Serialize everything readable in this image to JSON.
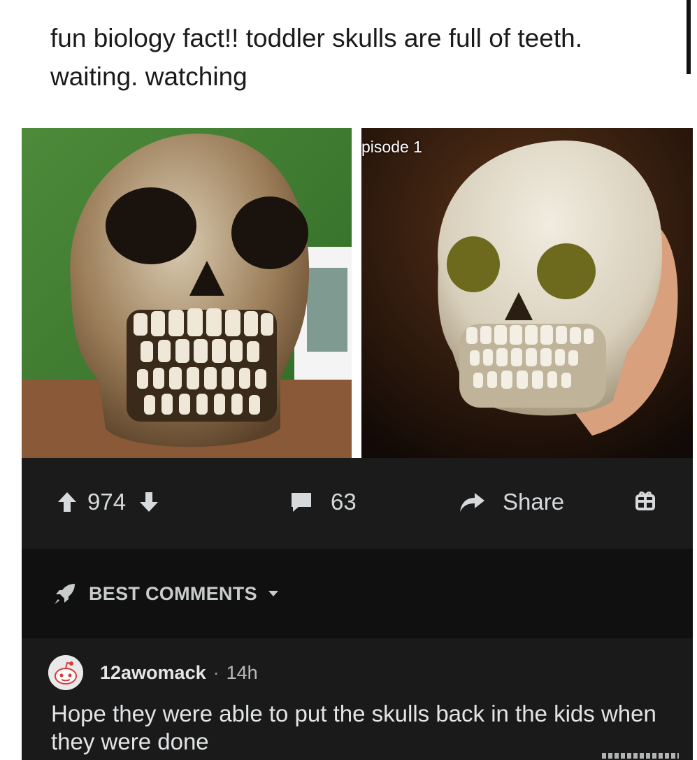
{
  "post": {
    "title": "fun biology fact!! toddler skulls are full of teeth. waiting. watching",
    "image_label": "pisode 1"
  },
  "actions": {
    "upvotes": "974",
    "comments": "63",
    "share_label": "Share"
  },
  "comments_section": {
    "sort_label": "BEST COMMENTS",
    "comments": [
      {
        "author": "12awomack",
        "separator": "·",
        "time": "14h",
        "text": "Hope they were able to put the skulls back in the kids when they were done"
      }
    ]
  },
  "icons": {
    "upvote": "arrow-up-icon",
    "downvote": "arrow-down-icon",
    "comment": "speech-bubble-icon",
    "share": "share-arrow-icon",
    "award": "gift-icon",
    "sort": "rocket-icon",
    "dropdown": "caret-down-icon"
  },
  "colors": {
    "background_dark": "#1a1a1b",
    "text_light": "#d7dadc"
  }
}
